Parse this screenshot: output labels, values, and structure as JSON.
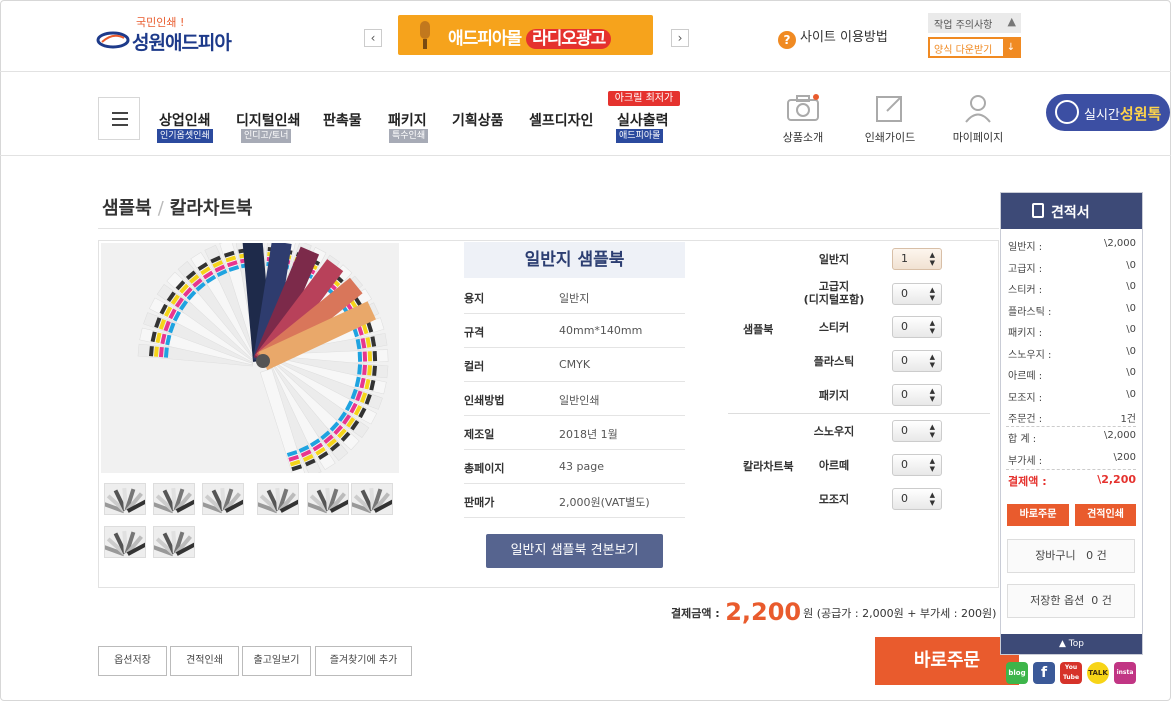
{
  "header": {
    "logo_tagline": "국민인쇄 !",
    "logo_name": "성원애드피아",
    "banner_text_1": "애드피아몰",
    "banner_text_2": "라디오광고",
    "help_label": "사이트 이용방법",
    "notice_label": "작업 주의사항",
    "download_label": "양식 다운받기"
  },
  "nav": {
    "items": [
      {
        "label": "상업인쇄",
        "sub": "인기옵셋인쇄"
      },
      {
        "label": "디지털인쇄",
        "sub": "인디고/토너"
      },
      {
        "label": "판촉물",
        "sub": ""
      },
      {
        "label": "패키지",
        "sub": "특수인쇄"
      },
      {
        "label": "기획상품",
        "sub": ""
      },
      {
        "label": "셀프디자인",
        "sub": ""
      },
      {
        "label": "실사출력",
        "sub": "애드피아몰"
      }
    ],
    "hot_badge": "아크릴 최저가",
    "icons": [
      {
        "label": "상품소개",
        "icon": "camera-icon"
      },
      {
        "label": "인쇄가이드",
        "icon": "external-link-icon"
      },
      {
        "label": "마이페이지",
        "icon": "user-icon"
      }
    ],
    "live_prefix": "실시간",
    "live_brand": "성원톡"
  },
  "breadcrumb": {
    "root": "샘플북",
    "sep": "/",
    "current": "칼라차트북"
  },
  "product": {
    "title": "일반지 샘플북",
    "specs": [
      {
        "key": "용지",
        "value": "일반지"
      },
      {
        "key": "규격",
        "value": "40mm*140mm"
      },
      {
        "key": "컬러",
        "value": "CMYK"
      },
      {
        "key": "인쇄방법",
        "value": "일반인쇄"
      },
      {
        "key": "제조일",
        "value": "2018년 1월"
      },
      {
        "key": "총페이지",
        "value": "43 page"
      },
      {
        "key": "판매가",
        "value": "2,000원(VAT별도)"
      }
    ],
    "view_button": "일반지 샘플북 견본보기"
  },
  "options": {
    "group1_label": "샘플북",
    "group2_label": "칼라차트북",
    "items": [
      {
        "label": "일반지",
        "value": "1"
      },
      {
        "label": "고급지\n(디지털포함)",
        "value": "0"
      },
      {
        "label": "스티커",
        "value": "0"
      },
      {
        "label": "플라스틱",
        "value": "0"
      },
      {
        "label": "패키지",
        "value": "0"
      },
      {
        "label": "스노우지",
        "value": "0"
      },
      {
        "label": "아르떼",
        "value": "0"
      },
      {
        "label": "모조지",
        "value": "0"
      }
    ]
  },
  "totals": {
    "label": "결제금액 :",
    "amount": "2,200",
    "detail": "원 (공급가 : 2,000원 + 부가세 : 200원)"
  },
  "bottom_buttons": [
    "옵션저장",
    "견적인쇄",
    "출고일보기",
    "즐겨찾기에 추가"
  ],
  "order_button": "바로주문",
  "estimate": {
    "title": "견적서",
    "rows": [
      {
        "label": "일반지 :",
        "value": "\\2,000"
      },
      {
        "label": "고급지 :",
        "value": "\\0"
      },
      {
        "label": "스티커 :",
        "value": "\\0"
      },
      {
        "label": "플라스틱 :",
        "value": "\\0"
      },
      {
        "label": "패키지 :",
        "value": "\\0"
      },
      {
        "label": "스노우지 :",
        "value": "\\0"
      },
      {
        "label": "아르떼 :",
        "value": "\\0"
      },
      {
        "label": "모조지 :",
        "value": "\\0"
      },
      {
        "label": "주문건 :",
        "value": "1건"
      }
    ],
    "sum_label": "합   계 :",
    "sum_value": "\\2,000",
    "vat_label": "부가세 :",
    "vat_value": "\\200",
    "pay_label": "결제액 :",
    "pay_value": "\\2,200",
    "order_btn": "바로주문",
    "print_btn": "견적인쇄",
    "cart_label": "장바구니",
    "cart_count": "0 건",
    "saved_label": "저장한 옵션",
    "saved_count": "0 건",
    "top_label": "▲ Top"
  },
  "social": [
    "blog",
    "f",
    "You Tube",
    "TALK",
    "insta"
  ],
  "colors": {
    "accent": "#e95b2d",
    "navy": "#3d4a77",
    "brand": "#1d3a8a"
  }
}
